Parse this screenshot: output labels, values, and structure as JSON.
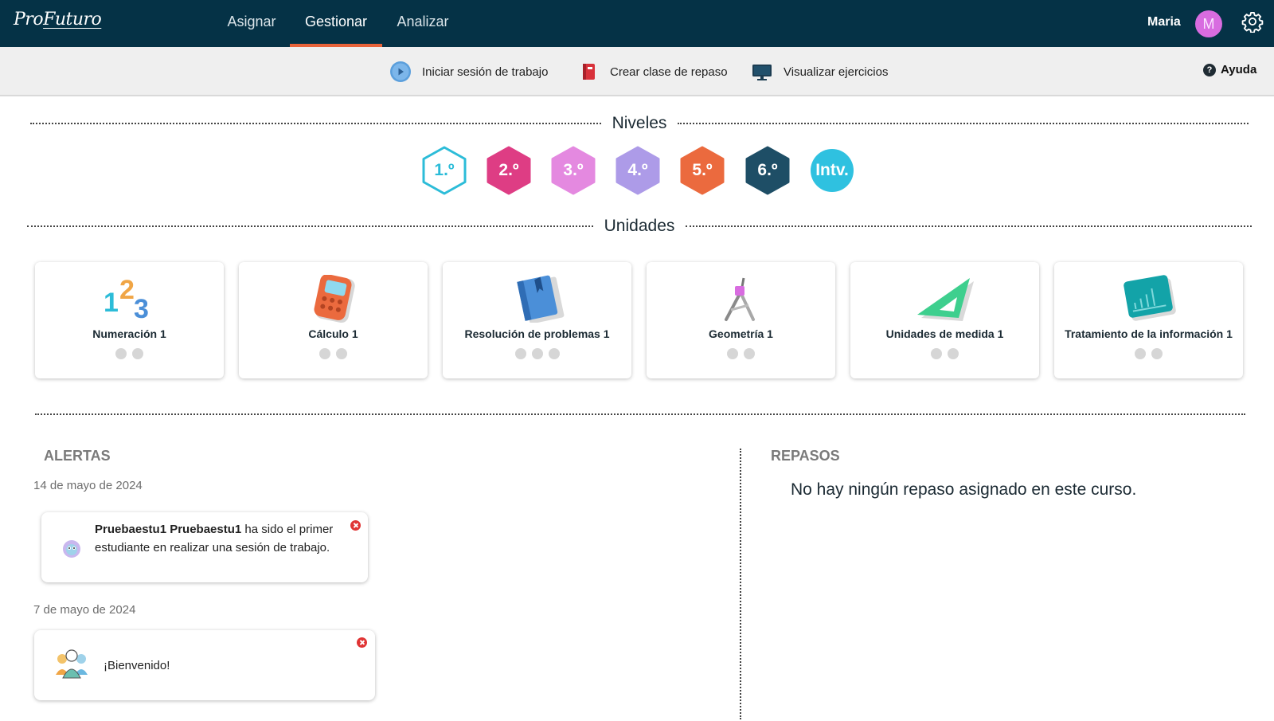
{
  "brand": {
    "logo_a": "Pro",
    "logo_b": "Futuro"
  },
  "nav": {
    "tabs": [
      {
        "label": "Asignar",
        "active": false
      },
      {
        "label": "Gestionar",
        "active": true
      },
      {
        "label": "Analizar",
        "active": false
      }
    ],
    "accent": "#e8633a"
  },
  "user": {
    "name": "Maria",
    "initial": "M",
    "avatar_color": "#d86ce0"
  },
  "toolbar": {
    "start_session": "Iniciar sesión de trabajo",
    "create_review": "Crear clase de repaso",
    "view_exercises": "Visualizar ejercicios",
    "help": "Ayuda"
  },
  "levels": {
    "title": "Niveles",
    "items": [
      {
        "label": "1.º",
        "color": "#2cbcd8",
        "selected": true
      },
      {
        "label": "2.º",
        "color": "#de3d84",
        "selected": false
      },
      {
        "label": "3.º",
        "color": "#e489e0",
        "selected": false
      },
      {
        "label": "4.º",
        "color": "#ad9be8",
        "selected": false
      },
      {
        "label": "5.º",
        "color": "#eb6a3e",
        "selected": false
      },
      {
        "label": "6.º",
        "color": "#1e4e66",
        "selected": false
      },
      {
        "label": "Intv.",
        "color": "#2fc1e0",
        "selected": false
      }
    ]
  },
  "units": {
    "title": "Unidades",
    "items": [
      {
        "name": "Numeración 1",
        "icon": "numbers-icon",
        "dots": 2
      },
      {
        "name": "Cálculo 1",
        "icon": "calculator-icon",
        "dots": 2
      },
      {
        "name": "Resolución de problemas 1",
        "icon": "book-icon",
        "dots": 3
      },
      {
        "name": "Geometría 1",
        "icon": "compass-icon",
        "dots": 2
      },
      {
        "name": "Unidades de medida 1",
        "icon": "set-square-icon",
        "dots": 2
      },
      {
        "name": "Tratamiento de la información 1",
        "icon": "chart-icon",
        "dots": 2
      }
    ]
  },
  "alerts": {
    "title": "ALERTAS",
    "groups": [
      {
        "date": "14 de mayo de 2024",
        "student": "Pruebaestu1 Pruebaestu1",
        "text": " ha sido el primer estudiante en realizar una sesión de trabajo."
      },
      {
        "date": "7 de mayo de 2024",
        "text": "¡Bienvenido!"
      }
    ]
  },
  "reviews": {
    "title": "REPASOS",
    "empty": "No hay ningún repaso asignado en este curso."
  }
}
